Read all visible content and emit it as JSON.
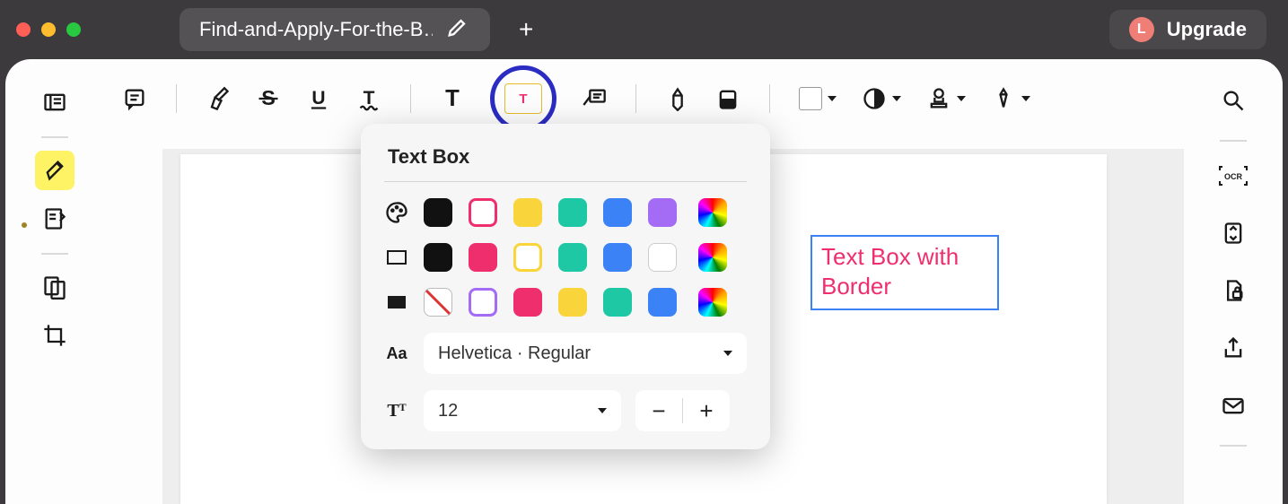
{
  "titlebar": {
    "tab_title": "Find-and-Apply-For-the-B…",
    "account_initial": "L",
    "upgrade_label": "Upgrade"
  },
  "toolbar": {
    "items": [
      "note",
      "highlighter",
      "strikethrough",
      "underline",
      "squiggly",
      "text",
      "textbox",
      "callout",
      "pencil",
      "eraser",
      "fill-color",
      "opacity",
      "stamp",
      "signature"
    ]
  },
  "popover": {
    "title": "Text Box",
    "text_color_row": {
      "label": "text-color",
      "swatches": [
        "#111111",
        "#ef2e6e",
        "#f9d43b",
        "#1fc8a4",
        "#3b82f6",
        "#a46bf5"
      ],
      "selected_index": 1
    },
    "border_color_row": {
      "label": "border-color",
      "swatches": [
        "#111111",
        "#ef2e6e",
        "#f9d43b",
        "#1fc8a4",
        "#3b82f6",
        "#ffffff"
      ],
      "selected_index": 2
    },
    "fill_color_row": {
      "label": "fill-color",
      "swatches": [
        "none",
        "#a46bf5",
        "#ef2e6e",
        "#f9d43b",
        "#1fc8a4",
        "#3b82f6"
      ],
      "selected_outline_index": 1
    },
    "font_label": "Helvetica · Regular",
    "font_size": "12"
  },
  "document": {
    "text_box_content": "Text Box with Border"
  },
  "colors": {
    "accent_ring": "#2b2cc2",
    "brand_pink": "#ef7e76"
  }
}
